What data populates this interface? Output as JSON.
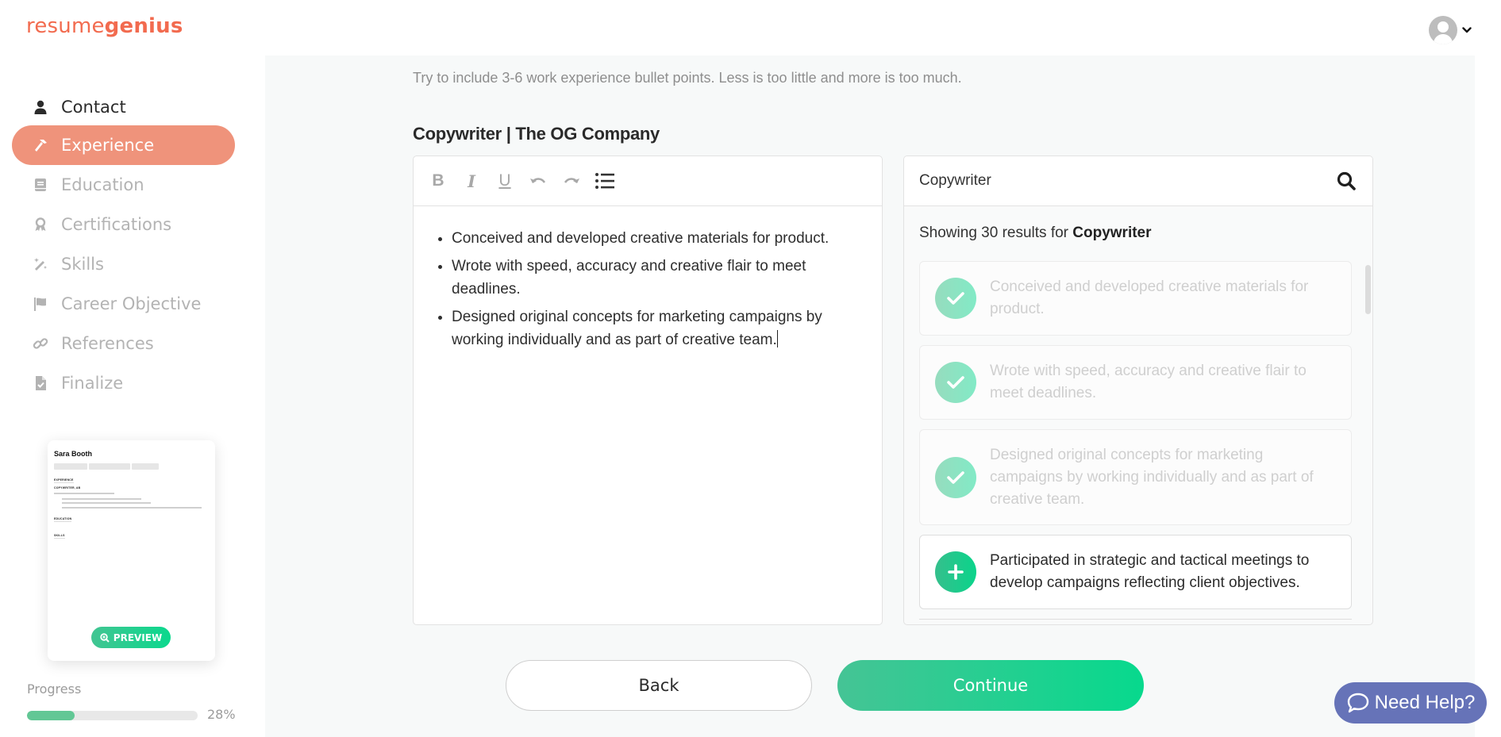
{
  "header": {
    "logo_light": "resume",
    "logo_bold": "genius",
    "user_menu_caret": "⌄"
  },
  "sidebar": {
    "items": [
      {
        "label": "Contact",
        "icon": "user-icon",
        "state": "done"
      },
      {
        "label": "Experience",
        "icon": "hammer-icon",
        "state": "active"
      },
      {
        "label": "Education",
        "icon": "book-icon",
        "state": "pending"
      },
      {
        "label": "Certifications",
        "icon": "award-icon",
        "state": "pending"
      },
      {
        "label": "Skills",
        "icon": "magic-wand-icon",
        "state": "pending"
      },
      {
        "label": "Career Objective",
        "icon": "flag-icon",
        "state": "pending"
      },
      {
        "label": "References",
        "icon": "link-icon",
        "state": "pending"
      },
      {
        "label": "Finalize",
        "icon": "file-check-icon",
        "state": "pending"
      }
    ],
    "preview": {
      "name": "Sara Booth",
      "section_experience": "EXPERIENCE",
      "job_line": "COPYWRITER, AB",
      "section_education": "EDUCATION",
      "section_skills": "SKILLS",
      "button_label": "PREVIEW"
    },
    "progress": {
      "label": "Progress",
      "percent_text": "28%",
      "value": 0.28
    }
  },
  "main": {
    "hint": "Try to include 3-6 work experience bullet points. Less is too little and more is too much.",
    "job_title": "Copywriter | The OG Company",
    "editor": {
      "toolbar": {
        "bold": "B",
        "italic": "I",
        "underline": "U"
      },
      "bullets": [
        "Conceived and developed creative materials for product.",
        "Wrote with speed, accuracy and creative flair to meet deadlines.",
        "Designed original concepts for marketing campaigns by working individually and as part of creative team."
      ]
    },
    "suggestions": {
      "search_value": "Copywriter",
      "results_prefix": "Showing 30 results for ",
      "results_term": "Copywriter",
      "items": [
        {
          "text": "Conceived and developed creative materials for product.",
          "state": "added"
        },
        {
          "text": "Wrote with speed, accuracy and creative flair to meet deadlines.",
          "state": "added"
        },
        {
          "text": "Designed original concepts for marketing campaigns by working individually and as part of creative team.",
          "state": "added"
        },
        {
          "text": "Participated in strategic and tactical meetings to develop campaigns reflecting client objectives.",
          "state": "available"
        }
      ]
    },
    "buttons": {
      "back": "Back",
      "continue": "Continue"
    }
  },
  "help": {
    "label": "Need Help?"
  },
  "colors": {
    "brand": "#f26b4f",
    "active_nav": "#ef937b",
    "green": "#0bd88d",
    "help": "#6673b8"
  }
}
